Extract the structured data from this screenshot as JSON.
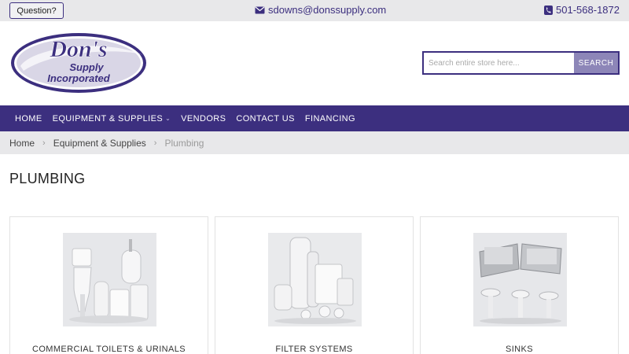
{
  "topbar": {
    "question_label": "Question?",
    "email": "sdowns@donssupply.com",
    "phone": "501-568-1872"
  },
  "logo": {
    "line1": "Don's",
    "line2": "Supply",
    "line3": "Incorporated"
  },
  "search": {
    "placeholder": "Search entire store here...",
    "button_label": "SEARCH"
  },
  "nav": {
    "items": [
      {
        "label": "HOME"
      },
      {
        "label": "EQUIPMENT & SUPPLIES"
      },
      {
        "label": "VENDORS"
      },
      {
        "label": "CONTACT US"
      },
      {
        "label": "FINANCING"
      }
    ]
  },
  "breadcrumb": {
    "items": [
      "Home",
      "Equipment & Supplies",
      "Plumbing"
    ]
  },
  "page": {
    "title": "PLUMBING"
  },
  "categories": [
    {
      "label": "COMMERCIAL TOILETS & URINALS",
      "icon": "toilets-urinals-image"
    },
    {
      "label": "FILTER SYSTEMS",
      "icon": "filter-systems-image"
    },
    {
      "label": "SINKS",
      "icon": "sinks-image"
    }
  ],
  "colors": {
    "brand": "#3c2f7f",
    "search_button": "#8d86b8",
    "topbar_bg": "#e8e8ea"
  }
}
